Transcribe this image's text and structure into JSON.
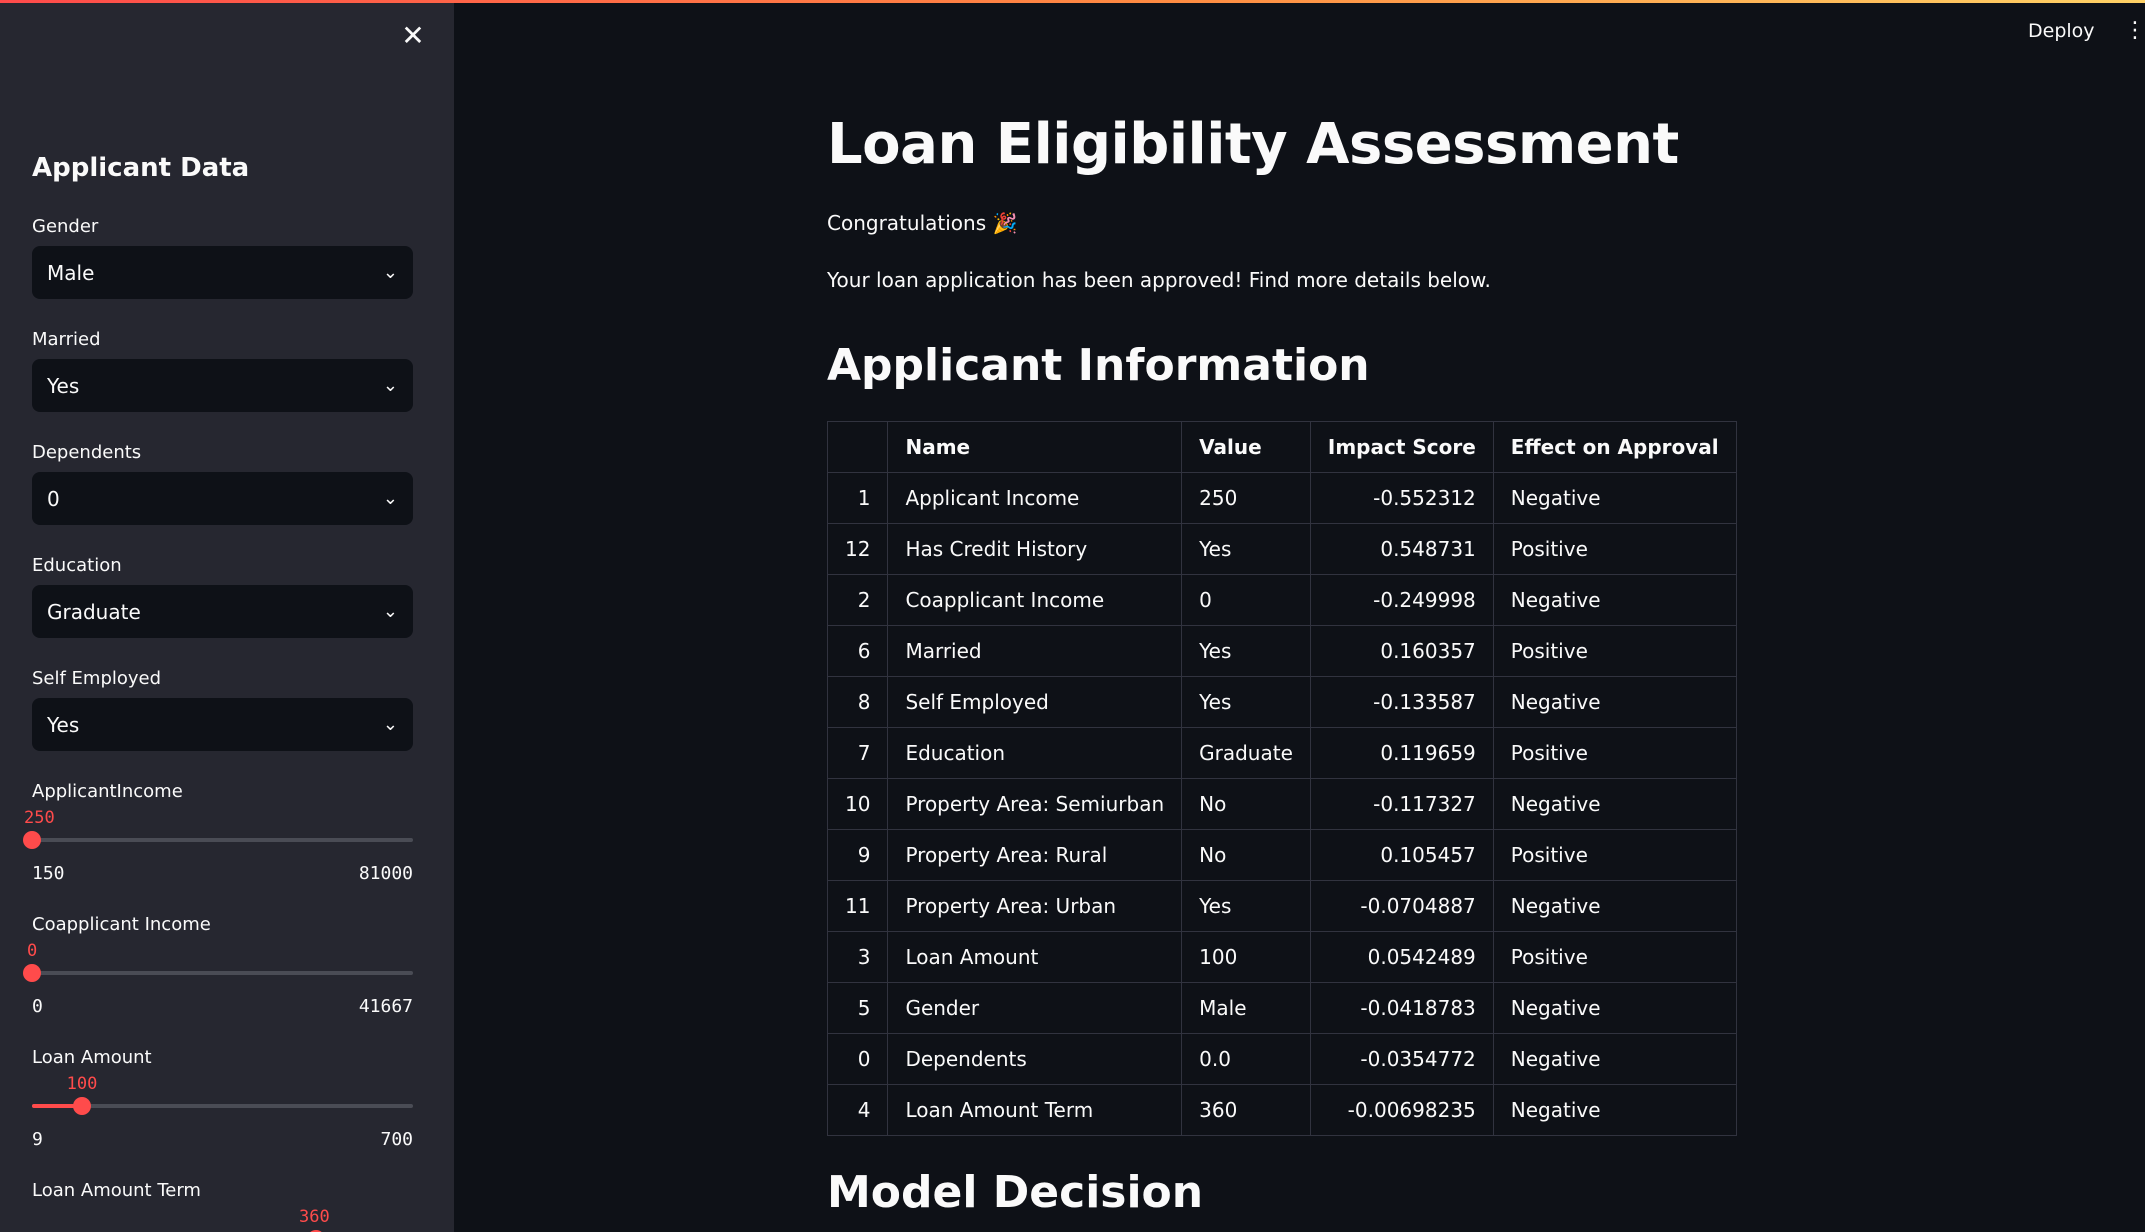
{
  "header": {
    "deploy_label": "Deploy",
    "menu_icon": "⋮"
  },
  "sidebar": {
    "close_icon": "✕",
    "title": "Applicant Data",
    "selects": [
      {
        "label": "Gender",
        "value": "Male"
      },
      {
        "label": "Married",
        "value": "Yes"
      },
      {
        "label": "Dependents",
        "value": "0"
      },
      {
        "label": "Education",
        "value": "Graduate"
      },
      {
        "label": "Self Employed",
        "value": "Yes"
      }
    ],
    "sliders": [
      {
        "label": "ApplicantIncome",
        "value": "250",
        "min": "150",
        "max": "81000",
        "fraction": 0.0012
      },
      {
        "label": "Coapplicant Income",
        "value": "0",
        "min": "0",
        "max": "41667",
        "fraction": 0.0
      },
      {
        "label": "Loan Amount",
        "value": "100",
        "min": "9",
        "max": "700",
        "fraction": 0.1317
      },
      {
        "label": "Loan Amount Term",
        "value": "360"
      }
    ]
  },
  "main": {
    "title": "Loan Eligibility Assessment",
    "congrats": "Congratulations 🎉",
    "message": "Your loan application has been approved! Find more details below.",
    "section_applicant": "Applicant Information",
    "section_decision": "Model Decision",
    "table": {
      "columns": [
        "",
        "Name",
        "Value",
        "Impact Score",
        "Effect on Approval"
      ],
      "rows": [
        [
          "1",
          "Applicant Income",
          "250",
          "-0.552312",
          "Negative"
        ],
        [
          "12",
          "Has Credit History",
          "Yes",
          "0.548731",
          "Positive"
        ],
        [
          "2",
          "Coapplicant Income",
          "0",
          "-0.249998",
          "Negative"
        ],
        [
          "6",
          "Married",
          "Yes",
          "0.160357",
          "Positive"
        ],
        [
          "8",
          "Self Employed",
          "Yes",
          "-0.133587",
          "Negative"
        ],
        [
          "7",
          "Education",
          "Graduate",
          "0.119659",
          "Positive"
        ],
        [
          "10",
          "Property Area: Semiurban",
          "No",
          "-0.117327",
          "Negative"
        ],
        [
          "9",
          "Property Area: Rural",
          "No",
          "0.105457",
          "Positive"
        ],
        [
          "11",
          "Property Area: Urban",
          "Yes",
          "-0.0704887",
          "Negative"
        ],
        [
          "3",
          "Loan Amount",
          "100",
          "0.0542489",
          "Positive"
        ],
        [
          "5",
          "Gender",
          "Male",
          "-0.0418783",
          "Negative"
        ],
        [
          "0",
          "Dependents",
          "0.0",
          "-0.0354772",
          "Negative"
        ],
        [
          "4",
          "Loan Amount Term",
          "360",
          "-0.00698235",
          "Negative"
        ]
      ]
    }
  },
  "colors": {
    "accent": "#ff4b4b",
    "background": "#0e1117",
    "sidebar": "#262730"
  }
}
